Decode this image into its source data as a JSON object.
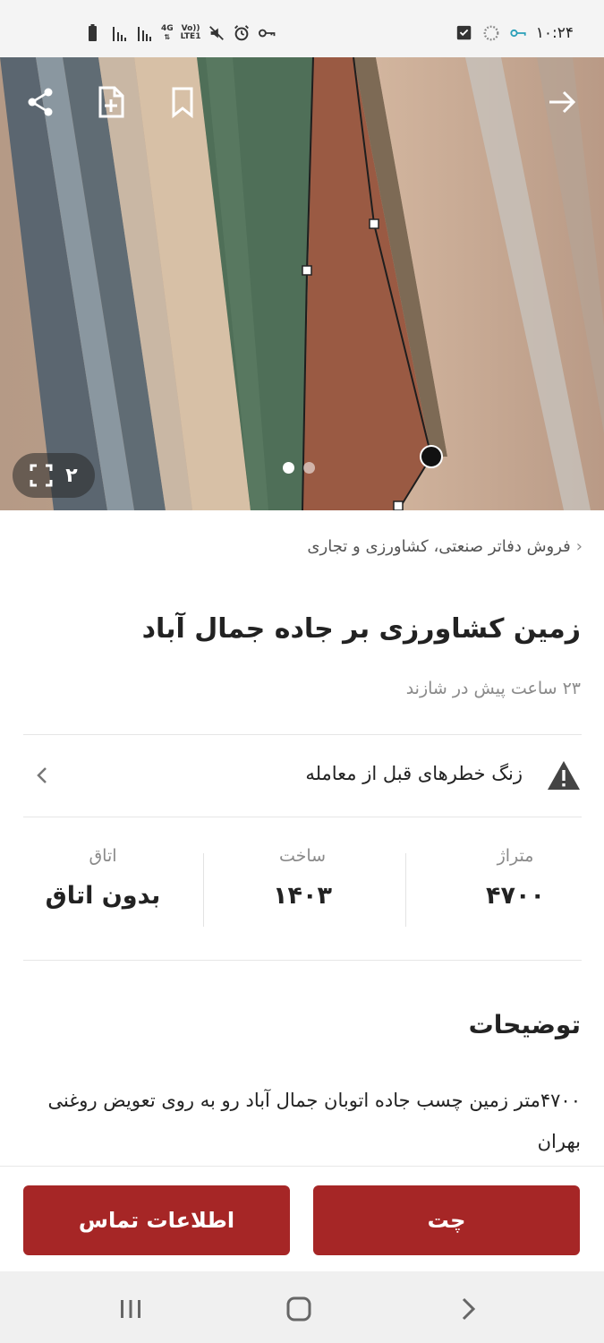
{
  "status_bar": {
    "time": "۱۰:۲۴",
    "network_top": "4G",
    "network_bottom": "LTE1",
    "volte": "Vo))",
    "icons": [
      "battery-icon",
      "signal-icon",
      "signal-icon",
      "mute-icon",
      "alarm-icon",
      "vpn-key-icon",
      "checkbox-notification-icon",
      "sync-icon",
      "key-icon"
    ]
  },
  "hero": {
    "gallery_count": "۲",
    "image_count": 2,
    "active_dot": 0,
    "icons": [
      "share-icon",
      "add-note-icon",
      "bookmark-icon",
      "back-arrow-icon",
      "fullscreen-icon"
    ]
  },
  "listing": {
    "breadcrumb": "فروش دفاتر صنعتی، کشاورزی و تجاری",
    "title": "زمین کشاورزی بر جاده جمال آباد",
    "subtitle": "۲۳ ساعت پیش در شازند",
    "warning": "زنگ خطرهای قبل از معامله",
    "stats": [
      {
        "label": "متراژ",
        "value": "۴۷۰۰"
      },
      {
        "label": "ساخت",
        "value": "۱۴۰۳"
      },
      {
        "label": "اتاق",
        "value": "بدون اتاق"
      }
    ],
    "description_title": "توضیحات",
    "description": "۴۷۰۰متر زمین چسب جاده اتوبان جمال آباد رو به روی تعویض روغنی بهران"
  },
  "actions": {
    "chat": "چت",
    "contact": "اطلاعات تماس"
  },
  "colors": {
    "primary": "#a62626",
    "muted_text": "#8a8a8a"
  }
}
